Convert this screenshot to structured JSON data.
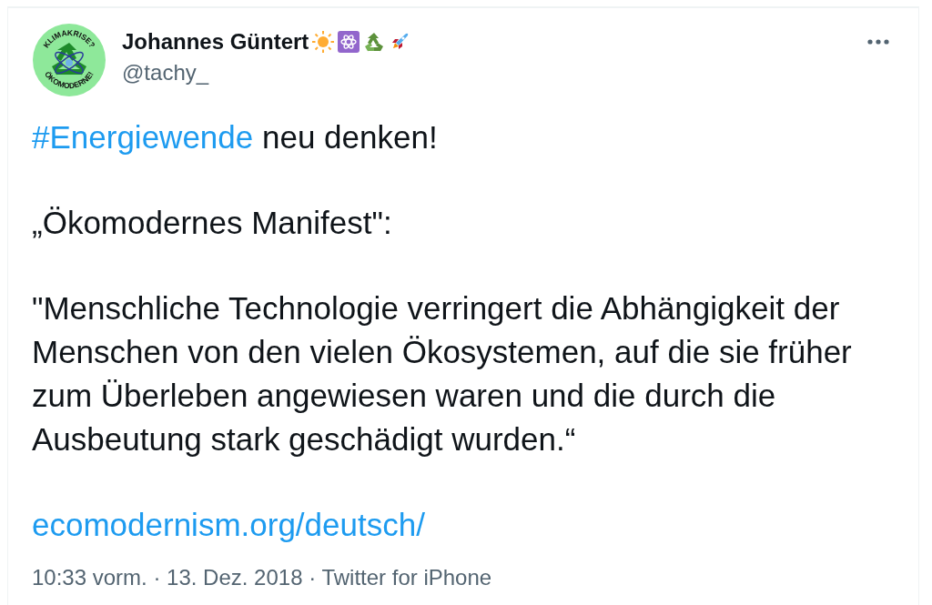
{
  "author": {
    "name": "Johannes Güntert",
    "handle": "@tachy_",
    "avatar": {
      "top_text": "KLIMAKRISE?",
      "bottom_text": "ÖKOMODERNE!"
    }
  },
  "tweet": {
    "hashtag": "#Energiewende",
    "headline_rest": " neu denken!",
    "title": "„Ökomodernes Manifest\":",
    "quote": "\"Menschliche Technologie verringert die Abhängigkeit der Menschen von den vielen Ökosystemen, auf die sie früher zum Überleben angewiesen waren und die durch die Ausbeutung stark geschädigt wurden.“",
    "link": "ecomodernism.org/deutsch/"
  },
  "meta": "10:33 vorm. · 13. Dez. 2018 · Twitter for iPhone"
}
